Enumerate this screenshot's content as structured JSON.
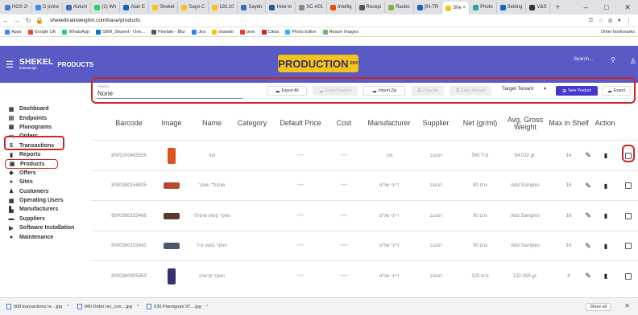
{
  "browser": {
    "tabs": [
      {
        "label": "HOS 2!",
        "color": "#4a7bd0"
      },
      {
        "label": "G pintw",
        "color": "#4285f4"
      },
      {
        "label": "Autum",
        "color": "#3a6fb5"
      },
      {
        "label": "(1) Wh",
        "color": "#25d366"
      },
      {
        "label": "Alan E",
        "color": "#0a66c2"
      },
      {
        "label": "Shekel",
        "color": "#f5c419"
      },
      {
        "label": "Sayo C",
        "color": "#f5c419"
      },
      {
        "label": "192.10",
        "color": "#f5c419"
      },
      {
        "label": "Saydn",
        "color": "#3a6fb5"
      },
      {
        "label": "How to",
        "color": "#2b579a"
      },
      {
        "label": "SC-A01",
        "color": "#888888"
      },
      {
        "label": "Intellig",
        "color": "#e65100"
      },
      {
        "label": "Recepi",
        "color": "#555555"
      },
      {
        "label": "Rasbo",
        "color": "#7cb342"
      },
      {
        "label": "[IN-TR",
        "color": "#1565c0"
      },
      {
        "label": "She ×",
        "color": "#f5c419",
        "active": true
      },
      {
        "label": "Photo",
        "color": "#26a69a"
      },
      {
        "label": "Setting",
        "color": "#1565c0"
      },
      {
        "label": "V&S",
        "color": "#333333"
      }
    ],
    "new_tab": "+",
    "window_controls": [
      "–",
      "□",
      "✕"
    ],
    "url": "shekelbrainweighin.com/base/products",
    "bookmarks": [
      {
        "label": "Apps",
        "color": "#4285f4"
      },
      {
        "label": "Google UK",
        "color": "#ea4335"
      },
      {
        "label": "WhatsApp",
        "color": "#25d366"
      },
      {
        "label": "SBW_Shared - One...",
        "color": "#0078d4"
      },
      {
        "label": "Pixelate - Blur",
        "color": "#555555"
      },
      {
        "label": "Jira",
        "color": "#2684ff"
      },
      {
        "label": "shawdo",
        "color": "#f5c419"
      },
      {
        "label": "pnei",
        "color": "#e53935"
      },
      {
        "label": "Cikas",
        "color": "#c62828"
      },
      {
        "label": "Photo Editor",
        "color": "#29b6f6"
      },
      {
        "label": "Resize Images",
        "color": "#66bb6a"
      }
    ],
    "other_bookmarks": "Other bookmarks"
  },
  "app": {
    "brand": "SHEKEL",
    "brand_sub": "brainweigh",
    "section": "PRODUCTS",
    "banner_title": "PRODUCTION",
    "banner_badge": "ENV",
    "search_placeholder": "Search...",
    "colors": {
      "header": "#5a5ac7",
      "banner": "#f5c419",
      "primary": "#4338ca",
      "highlight": "#c62828"
    }
  },
  "sidebar": {
    "items": [
      {
        "label": "Dashboard",
        "icon": "dashboard-icon"
      },
      {
        "label": "Endpoints",
        "icon": "endpoints-icon"
      },
      {
        "label": "Planograms",
        "icon": "grid-icon"
      },
      {
        "label": "Orders",
        "icon": "list-icon"
      },
      {
        "label": "Transactions",
        "icon": "dollar-icon"
      },
      {
        "label": "Reports",
        "icon": "bar-chart-icon"
      },
      {
        "label": "Products",
        "icon": "cart-icon",
        "selected": true
      },
      {
        "label": "Offers",
        "icon": "tag-icon"
      },
      {
        "label": "Sites",
        "icon": "location-icon"
      },
      {
        "label": "Customers",
        "icon": "people-icon"
      },
      {
        "label": "Operating Users",
        "icon": "user-icon"
      },
      {
        "label": "Manufacturers",
        "icon": "factory-icon"
      },
      {
        "label": "Suppliers",
        "icon": "truck-icon"
      },
      {
        "label": "Software Installation",
        "icon": "play-icon"
      },
      {
        "label": "Maintenance",
        "icon": "info-icon"
      }
    ]
  },
  "toolbar": {
    "picklist_label": "Picklist",
    "picklist_value": "None",
    "export_all": "Export All",
    "export_marked": "Export Marked",
    "import_zip": "Import Zip",
    "copy_all": "Copy All",
    "copy_marked": "Copy Marked",
    "target_tenant": "Target Tenant",
    "new_product": "New Product",
    "export": "Export"
  },
  "table": {
    "headers": [
      "Barcode",
      "Image",
      "Name",
      "Category",
      "Default Price",
      "Cost",
      "Manufacturer",
      "Supplier",
      "Net (gr/ml)",
      "Avg. Gross Weight",
      "Max in Shelf",
      "Action"
    ],
    "rows": [
      {
        "barcode": "8005200465326",
        "image_color": "#d9541e",
        "name": "פוני",
        "category": "",
        "default_price": "••••",
        "cost": "••••",
        "manufacturer": "פוני",
        "supplier": "הנענב",
        "net": "מ\"ל 500",
        "avg_gross": "54.032 gr.",
        "max_shelf": "14"
      },
      {
        "barcode": "8000380156825",
        "image_color": "#b64a33",
        "name": "שוקולד וואקר",
        "category": "",
        "default_price": "••••",
        "cost": "••••",
        "manufacturer": "דייני שליט",
        "supplier": "הנענב",
        "net": "גרם 90",
        "avg_gross": "Add Samples",
        "max_shelf": "16"
      },
      {
        "barcode": "8000380153466",
        "image_color": "#5a3a2a",
        "name": "וואקר קקאו שוקולד",
        "category": "",
        "default_price": "••••",
        "cost": "••••",
        "manufacturer": "דייני שליט",
        "supplier": "הנענב",
        "net": "גרם 90",
        "avg_gross": "Add Samples",
        "max_shelf": "16"
      },
      {
        "barcode": "8000380153442",
        "image_color": "#4a5a6a",
        "name": "וואקר קקאו וניל",
        "category": "",
        "default_price": "••••",
        "cost": "••••",
        "manufacturer": "דייני שליט",
        "supplier": "הנענב",
        "net": "גרם 90",
        "avg_gross": "Add Samples",
        "max_shelf": "16"
      },
      {
        "barcode": "8000380005963",
        "image_color": "#35306e",
        "name": "וואקר קרוציק",
        "category": "",
        "default_price": "••••",
        "cost": "••••",
        "manufacturer": "דייני שליט",
        "supplier": "הנענב",
        "net": "גרם 125",
        "avg_gross": "132.059 gr.",
        "max_shelf": "8"
      }
    ]
  },
  "downloads": {
    "items": [
      "008 transactions re....jpg",
      "040 Order rec_con....jpg",
      "030 Planogram 97....jpg"
    ],
    "show_all": "Show all"
  }
}
